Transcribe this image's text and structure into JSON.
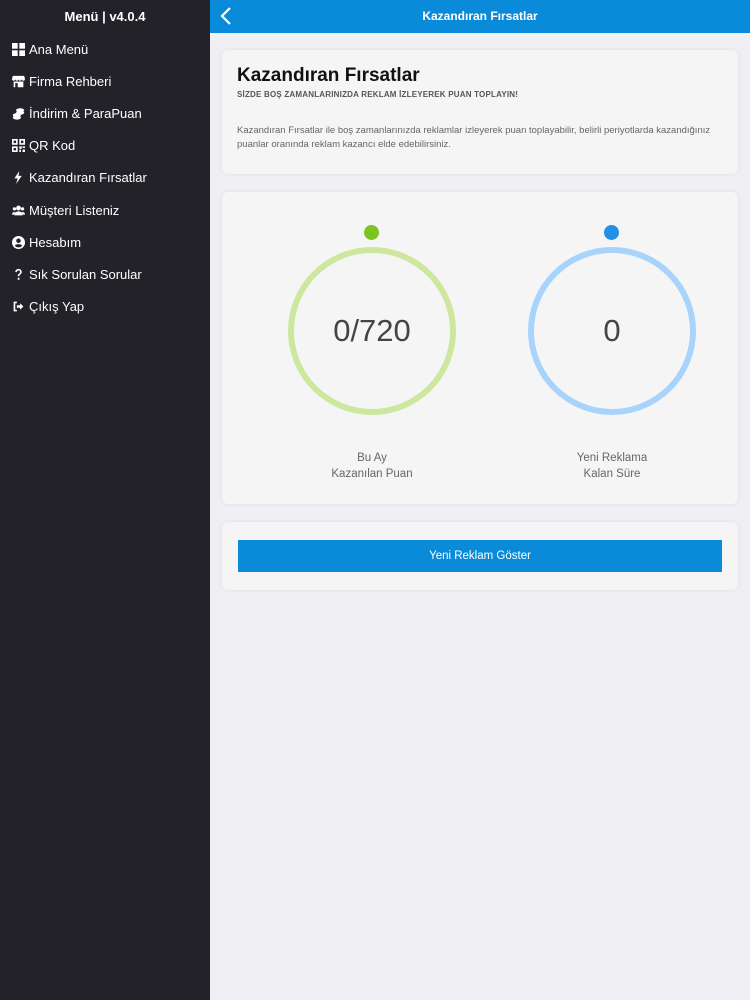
{
  "sidebar": {
    "title": "Menü | v4.0.4",
    "items": [
      {
        "label": "Ana Menü",
        "icon": "grid-icon"
      },
      {
        "label": "Firma Rehberi",
        "icon": "store-icon"
      },
      {
        "label": "İndirim & ParaPuan",
        "icon": "coins-icon"
      },
      {
        "label": "QR Kod",
        "icon": "qr-code-icon"
      },
      {
        "label": "Kazandıran Fırsatlar",
        "icon": "lightning-icon"
      },
      {
        "label": "Müşteri Listeniz",
        "icon": "users-icon"
      },
      {
        "label": "Hesabım",
        "icon": "user-circle-icon"
      },
      {
        "label": "Sık Sorulan Sorular",
        "icon": "question-icon"
      },
      {
        "label": "Çıkış Yap",
        "icon": "sign-out-icon"
      }
    ]
  },
  "header": {
    "title": "Kazandıran Fırsatlar",
    "back_icon": "chevron-left-icon"
  },
  "info": {
    "title": "Kazandıran Fırsatlar",
    "subtitle": "SİZDE BOŞ ZAMANLARINIZDA REKLAM İZLEYEREK PUAN TOPLAYIN!",
    "description": "Kazandıran Fırsatlar ile boş zamanlarınızda reklamlar izleyerek puan toplayabilir, belirli periyotlarda kazandığınız puanlar oranında reklam kazancı elde edebilirsiniz."
  },
  "stats": {
    "points": {
      "value": "0/720",
      "label_line1": "Bu Ay",
      "label_line2": "Kazanılan Puan",
      "dot_color": "#7cc41f",
      "ring_color": "#cde89e"
    },
    "timer": {
      "value": "0",
      "label_line1": "Yeni Reklama",
      "label_line2": "Kalan Süre",
      "dot_color": "#2090e8",
      "ring_color": "#a8d4fc"
    }
  },
  "actions": {
    "show_ad_label": "Yeni Reklam Göster"
  },
  "colors": {
    "accent": "#0a8bd9",
    "sidebar_bg": "#222228"
  }
}
